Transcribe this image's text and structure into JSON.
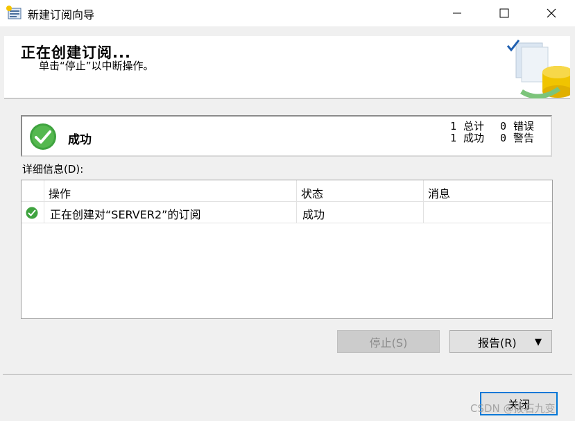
{
  "window": {
    "title": "新建订阅向导",
    "minimize_glyph": "—",
    "maximize_glyph": "☐",
    "close_glyph": "✕"
  },
  "header": {
    "title": "正在创建订阅...",
    "subtitle": "单击“停止”以中断操作。",
    "art_icon": "database-check-icon"
  },
  "status": {
    "icon": "success-check-icon",
    "text": "成功",
    "stats": [
      {
        "value1": "1",
        "label1": "总计",
        "value2": "0",
        "label2": "错误"
      },
      {
        "value1": "1",
        "label1": "成功",
        "value2": "0",
        "label2": "警告"
      }
    ]
  },
  "details": {
    "label": "详细信息(D):",
    "columns": [
      "",
      "操作",
      "状态",
      "消息"
    ],
    "rows": [
      {
        "icon": "success-check-icon",
        "operation": "正在创建对“SERVER2”的订阅",
        "status": "成功",
        "message": ""
      }
    ]
  },
  "buttons": {
    "stop": "停止(S)",
    "report": "报告(R)",
    "report_arrow": "▼",
    "close": "关闭"
  },
  "watermark": "CSDN @拨石九变",
  "colors": {
    "accent": "#0078d7",
    "success_green": "#3fa33f"
  }
}
